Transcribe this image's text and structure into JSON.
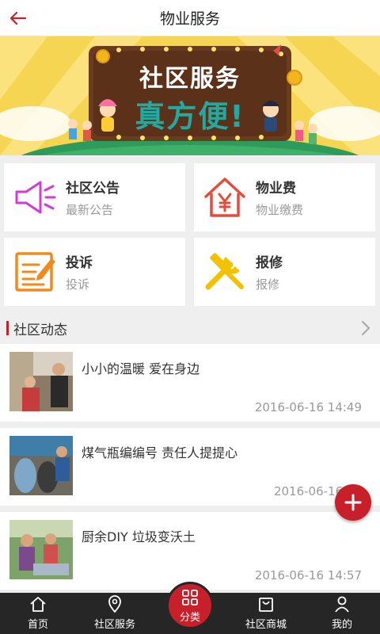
{
  "header": {
    "title": "物业服务"
  },
  "banner": {
    "line1": "社区服务",
    "line2": "真方便!"
  },
  "services": [
    {
      "title": "社区公告",
      "subtitle": "最新公告",
      "icon": "megaphone-icon",
      "color": "#d63ad6"
    },
    {
      "title": "物业费",
      "subtitle": "物业缴费",
      "icon": "house-yen-icon",
      "color": "#e54c3c"
    },
    {
      "title": "投诉",
      "subtitle": "投诉",
      "icon": "notepad-pen-icon",
      "color": "#f08a1c"
    },
    {
      "title": "报修",
      "subtitle": "报修",
      "icon": "wrench-hammer-icon",
      "color": "#f2c200"
    }
  ],
  "section": {
    "title": "社区动态"
  },
  "news": [
    {
      "title": "小小的温暖 爱在身边",
      "time": "2016-06-16 14:49"
    },
    {
      "title": "煤气瓶编编号 责任人提提心",
      "time": "2016-06-16 15"
    },
    {
      "title": "厨余DIY 垃圾变沃土",
      "time": "2016-06-16 14:57"
    }
  ],
  "tabbar": {
    "home": "首页",
    "community": "社区服务",
    "category": "分类",
    "mall": "社区商城",
    "mine": "我的"
  },
  "colors": {
    "accent": "#c8202a",
    "tabbar_bg": "#262626",
    "page_bg": "#efefef"
  }
}
